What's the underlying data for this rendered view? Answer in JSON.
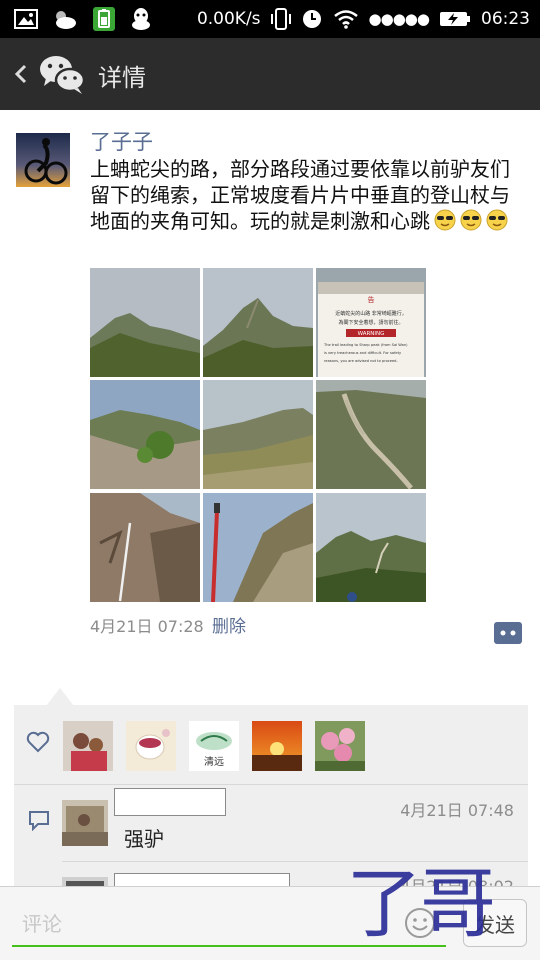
{
  "status_bar": {
    "network_speed": "0.00K/s",
    "signal_dots": "●●●●●",
    "time": "06:23",
    "icons": [
      "gallery-icon",
      "weather-icon",
      "battery-app-icon",
      "qq-icon",
      "vibrate-icon",
      "alarm-icon",
      "wifi-icon",
      "battery-charging-icon"
    ]
  },
  "header": {
    "title": "详情",
    "back_icon": "chevron-left-icon",
    "app_icon": "wechat-icon"
  },
  "post": {
    "username": "了子子",
    "text": "上蚺蛇尖的路，部分路段通过要依靠以前驴友们留下的绳索，正常坡度看片片中垂直的登山杖与地面的夹角可知。玩的就是刺激和心跳",
    "emoji_count": 3,
    "emoji_icon": "cool-sunglasses-emoji-icon",
    "photos": [
      {
        "name": "photo-mountain-peak-1"
      },
      {
        "name": "photo-mountain-peak-2"
      },
      {
        "name": "photo-warning-sign",
        "sign_title": "告",
        "sign_text_1": "近蚺蛇尖的山路 非常崎嶇難行，",
        "sign_text_2": "為閣下安全着想，請勿前往。",
        "sign_warning": "WARNING",
        "sign_en_1": "The trail leading to Sharp peak (from Sai Wan)",
        "sign_en_2": "is very treacherous and difficult. For safety",
        "sign_en_3": "reasons, you are advised not to proceed."
      },
      {
        "name": "photo-rocky-trail"
      },
      {
        "name": "photo-ridge-grass"
      },
      {
        "name": "photo-eroded-slope"
      },
      {
        "name": "photo-rope-rock"
      },
      {
        "name": "photo-trekking-pole"
      },
      {
        "name": "photo-valley-view"
      }
    ],
    "date": "4月21日 07:28",
    "delete_label": "删除",
    "more_icon": "more-comment-icon"
  },
  "interactions": {
    "like_icon": "heart-icon",
    "comment_icon": "comment-icon",
    "like_avatars": [
      "avatar-family",
      "avatar-tea-cup",
      "avatar-calligraphy",
      "avatar-sunset",
      "avatar-peach-blossom"
    ],
    "like_avatar_caption": "清远",
    "comments": [
      {
        "time": "4月21日 07:48",
        "text": "强驴"
      },
      {
        "time": "4月21日 08:02",
        "text": ""
      }
    ]
  },
  "input": {
    "placeholder": "评论",
    "send_label": "发送",
    "emoji_icon": "smiley-icon"
  },
  "watermark": "了哥",
  "colors": {
    "header_bg": "#2c2c2c",
    "link": "#5a6d93",
    "accent_green": "#45c01a",
    "watermark": "#2c2e98"
  }
}
